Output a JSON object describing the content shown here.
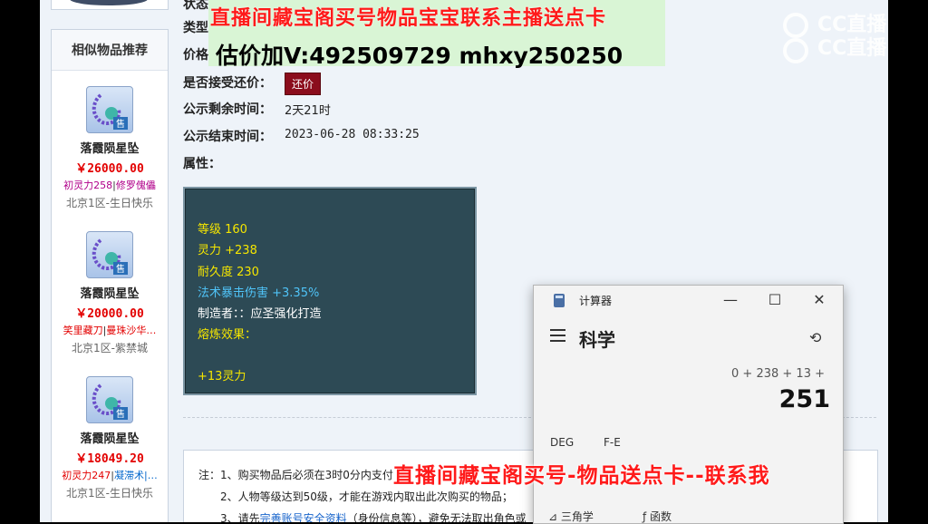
{
  "sidebar": {
    "title": "相似物品推荐",
    "items": [
      {
        "name": "落霞陨星坠",
        "price": "￥26000.00",
        "attr1": "初灵力258",
        "attr2": "修罗傀儡",
        "server": "北京1区-生日快乐",
        "badge": "售"
      },
      {
        "name": "落霞陨星坠",
        "price": "￥20000.00",
        "attr1": "笑里藏刀",
        "attr2": "曼珠沙华…",
        "server": "北京1区-紫禁城",
        "badge": "售"
      },
      {
        "name": "落霞陨星坠",
        "price": "￥18049.20",
        "attr1": "初灵力247",
        "attr2": "凝滞术|…",
        "server": "北京1区-生日快乐",
        "badge": "售"
      }
    ]
  },
  "info": {
    "status_label": "状态",
    "type_label": "类型",
    "price_label": "价格",
    "counter_label": "是否接受还价：",
    "counter_button": "还价",
    "remaining_label": "公示剩余时间：",
    "remaining_value": "2天21时",
    "end_label": "公示结束时间：",
    "end_value": "2023-06-28 08:33:25",
    "attrs_label": "属性："
  },
  "stats": {
    "level": "等级 160",
    "spirit": "灵力 +238",
    "durability": "耐久度 230",
    "crit": "法术暴击伤害 +3.35%",
    "maker": "制造者：：应圣强化打造",
    "refine_label": "熔炼效果：",
    "refine_value": "+13灵力"
  },
  "notice": {
    "line1_prefix": "注：1、购买物品后必须在3时0分内支付",
    "line2": "2、人物等级达到50级，才能在游戏内取出此次购买的物品；",
    "line3_prefix": "3、请先",
    "line3_link": "完善账号安全资料",
    "line3_suffix": "（身份信息等），避免无法取出角色或"
  },
  "calculator": {
    "title": "计算器",
    "mode": "科学",
    "expression": "0 + 238 + 13 +",
    "result": "251",
    "deg": "DEG",
    "fe": "F-E",
    "trig": "三角学",
    "func": "函数",
    "min": "—",
    "max": "☐",
    "close": "✕"
  },
  "overlay": {
    "top_line1": "直播间藏宝阁买号物品宝宝联系主播送点卡",
    "top_line2": "估价加V:492509729    mhxy250250",
    "bottom": "直播间藏宝阁买号-物品送点卡--联系我",
    "watermark1": "CC直播",
    "watermark2": "CC直播"
  },
  "colors": {
    "price_red": "#e30000",
    "stat_yellow": "#f5e600",
    "stat_blue": "#4fc3f7",
    "statbox_bg": "#2d4a55",
    "counter_btn": "#8b0d1c"
  }
}
